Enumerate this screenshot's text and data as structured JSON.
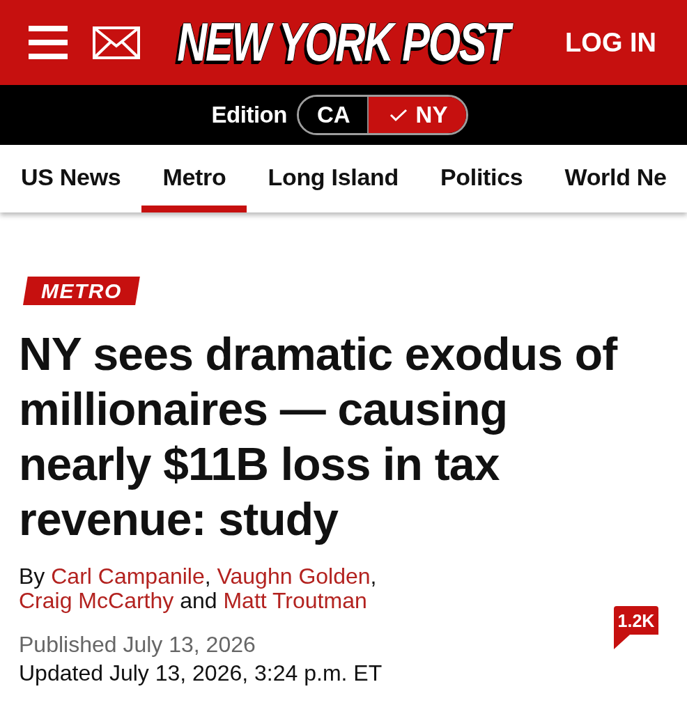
{
  "header": {
    "logo": "NEW YORK POST",
    "login": "LOG IN"
  },
  "edition": {
    "label": "Edition",
    "options": [
      {
        "label": "CA",
        "selected": false
      },
      {
        "label": "NY",
        "selected": true
      }
    ]
  },
  "nav": {
    "tabs": [
      {
        "label": "US News",
        "selected": false
      },
      {
        "label": "Metro",
        "selected": true
      },
      {
        "label": "Long Island",
        "selected": false
      },
      {
        "label": "Politics",
        "selected": false
      },
      {
        "label": "World Ne",
        "selected": false
      }
    ]
  },
  "article": {
    "section": "METRO",
    "headline": "NY sees dramatic exodus of millionaires — causing nearly $11B loss in tax revenue: study",
    "byline": [
      {
        "kind": "text",
        "text": "By "
      },
      {
        "kind": "author",
        "text": "Carl Campanile"
      },
      {
        "kind": "text",
        "text": ", "
      },
      {
        "kind": "author",
        "text": "Vaughn Golden"
      },
      {
        "kind": "text",
        "text": ", "
      },
      {
        "kind": "author",
        "text": "Craig McCarthy"
      },
      {
        "kind": "text",
        "text": " and "
      },
      {
        "kind": "author",
        "text": "Matt Troutman"
      }
    ],
    "published": "Published July 13, 2026",
    "updated": "Updated July 13, 2026, 3:24 p.m. ET",
    "comment_count": "1.2K"
  }
}
